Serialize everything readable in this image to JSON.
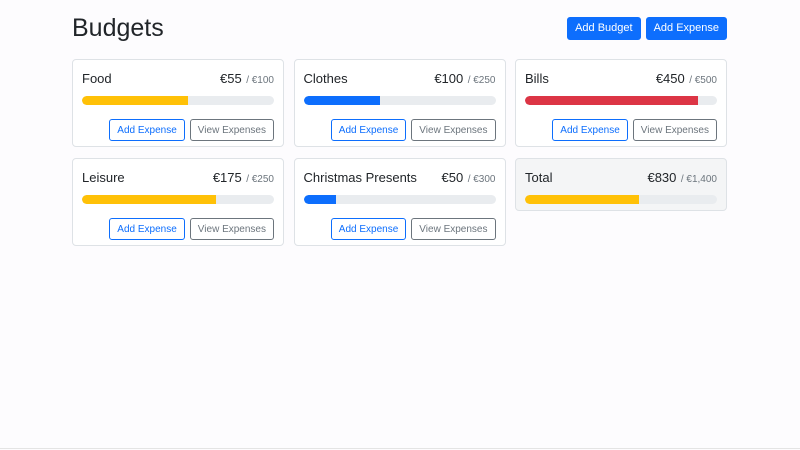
{
  "header": {
    "title": "Budgets",
    "add_budget": "Add Budget",
    "add_expense": "Add Expense"
  },
  "budgets": [
    {
      "name": "Food",
      "amount": "€55",
      "max": "/ €100",
      "progress": 0.55,
      "color": "#ffc107",
      "add": "Add Expense",
      "view": "View Expenses"
    },
    {
      "name": "Clothes",
      "amount": "€100",
      "max": "/ €250",
      "progress": 0.4,
      "color": "#0d6efd",
      "add": "Add Expense",
      "view": "View Expenses"
    },
    {
      "name": "Bills",
      "amount": "€450",
      "max": "/ €500",
      "progress": 0.9,
      "color": "#dc3545",
      "add": "Add Expense",
      "view": "View Expenses"
    },
    {
      "name": "Leisure",
      "amount": "€175",
      "max": "/ €250",
      "progress": 0.7,
      "color": "#ffc107",
      "add": "Add Expense",
      "view": "View Expenses"
    },
    {
      "name": "Christmas Presents",
      "amount": "€50",
      "max": "/ €300",
      "progress": 0.167,
      "color": "#0d6efd",
      "add": "Add Expense",
      "view": "View Expenses"
    }
  ],
  "total": {
    "name": "Total",
    "amount": "€830",
    "max": "/ €1,400",
    "progress": 0.593,
    "color": "#ffc107"
  }
}
